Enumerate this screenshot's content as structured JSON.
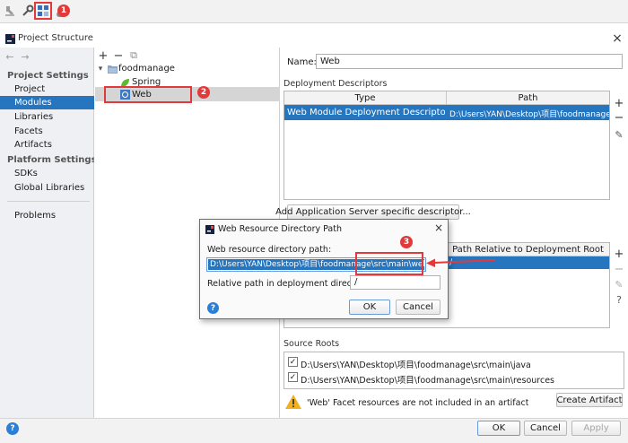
{
  "window": {
    "title": "Project Structure",
    "close_glyph": "×"
  },
  "nav": {
    "back_glyph": "←",
    "forward_glyph": "→",
    "project_settings_header": "Project Settings",
    "platform_settings_header": "Platform Settings",
    "items": [
      {
        "label": "Project"
      },
      {
        "label": "Modules",
        "selected": true
      },
      {
        "label": "Libraries"
      },
      {
        "label": "Facets"
      },
      {
        "label": "Artifacts"
      },
      {
        "label": "SDKs"
      },
      {
        "label": "Global Libraries"
      },
      {
        "label": "Problems"
      }
    ]
  },
  "tree": {
    "toolbar": [
      "+",
      "−",
      "⧉"
    ],
    "nodes": [
      {
        "label": "foodmanage",
        "icon": "folder-icon",
        "expander": "▾"
      },
      {
        "label": "Spring",
        "icon": "spring-leaf-icon"
      },
      {
        "label": "Web",
        "icon": "web-facet-icon",
        "selected": true
      }
    ]
  },
  "details": {
    "name_label": "Name:",
    "name_value": "Web",
    "descriptors_header": "Deployment Descriptors",
    "descriptors_columns": [
      "Type",
      "Path"
    ],
    "descriptors_rows": [
      {
        "type": "Web Module Deployment Descriptor",
        "path": "D:\\Users\\YAN\\Desktop\\项目\\foodmanage\\sr"
      }
    ],
    "side_tools": [
      "+",
      "−",
      "✎"
    ],
    "add_server_button": "Add Application Server specific descriptor...",
    "resource_columns_right": "Path Relative to Deployment Root",
    "resource_rows": [
      {
        "path": "/"
      }
    ],
    "resource_side_tools": [
      "+",
      "−",
      "✎",
      "?"
    ],
    "source_roots_header": "Source Roots",
    "source_roots": [
      {
        "checked": true,
        "path": "D:\\Users\\YAN\\Desktop\\项目\\foodmanage\\src\\main\\java"
      },
      {
        "checked": true,
        "path": "D:\\Users\\YAN\\Desktop\\项目\\foodmanage\\src\\main\\resources"
      }
    ],
    "warning_text": "'Web' Facet resources are not included in an artifact",
    "create_artifact_button": "Create Artifact"
  },
  "footer": {
    "ok": "OK",
    "cancel": "Cancel",
    "apply": "Apply",
    "help": "?"
  },
  "dialog": {
    "title": "Web Resource Directory Path",
    "close_glyph": "×",
    "dir_label": "Web resource directory path:",
    "dir_value": "D:\\Users\\YAN\\Desktop\\项目\\foodmanage\\src\\main\\webapp",
    "rel_label": "Relative path in deployment directory:",
    "rel_value": "/",
    "ok": "OK",
    "cancel": "Cancel",
    "help": "?"
  },
  "annotations": [
    "1",
    "2",
    "3"
  ],
  "colors": {
    "selection": "#2675bf",
    "annotation_red": "#e23a3a",
    "left_panel": "#eef0f3"
  }
}
